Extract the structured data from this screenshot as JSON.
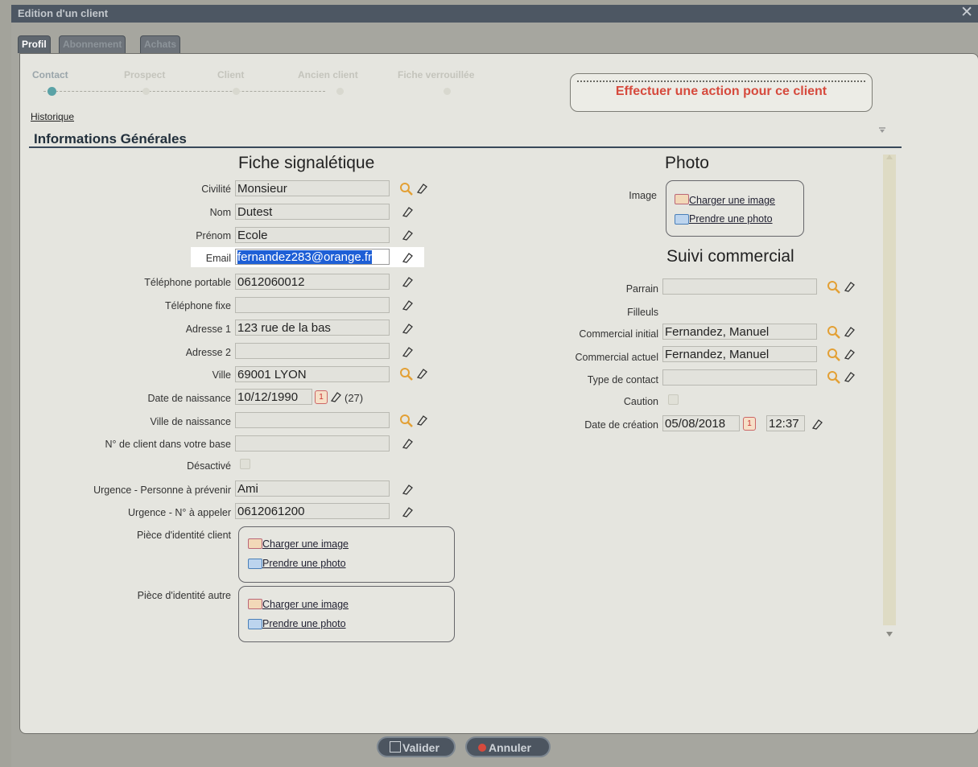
{
  "window": {
    "title": "Edition d'un client"
  },
  "tabs": [
    {
      "label": "Profil",
      "active": true
    },
    {
      "label": "Abonnement",
      "active": false
    },
    {
      "label": "Achats",
      "active": false
    }
  ],
  "stepper": [
    "Contact",
    "Prospect",
    "Client",
    "Ancien client",
    "Fiche verrouillée"
  ],
  "action_button": "Effectuer une action pour ce client",
  "historique_link": "Historique",
  "section_title": "Informations Générales",
  "fiche": {
    "heading": "Fiche signalétique",
    "fields": {
      "civilite": {
        "label": "Civilité",
        "value": "Monsieur"
      },
      "nom": {
        "label": "Nom",
        "value": "Dutest"
      },
      "prenom": {
        "label": "Prénom",
        "value": "Ecole"
      },
      "email": {
        "label": "Email",
        "value": "fernandez283@orange.fr"
      },
      "tel_portable": {
        "label": "Téléphone portable",
        "value": "0612060012"
      },
      "tel_fixe": {
        "label": "Téléphone fixe",
        "value": ""
      },
      "adresse1": {
        "label": "Adresse 1",
        "value": "123 rue de la bas"
      },
      "adresse2": {
        "label": "Adresse 2",
        "value": ""
      },
      "ville": {
        "label": "Ville",
        "value": "69001 LYON"
      },
      "date_naissance": {
        "label": "Date de naissance",
        "value": "10/12/1990",
        "age": "(27)"
      },
      "ville_naissance": {
        "label": "Ville de naissance",
        "value": ""
      },
      "num_client": {
        "label": "N° de client dans votre base",
        "value": ""
      },
      "desactive": {
        "label": "Désactivé"
      },
      "urgence_personne": {
        "label": "Urgence - Personne à prévenir",
        "value": "Ami"
      },
      "urgence_numero": {
        "label": "Urgence - N° à appeler",
        "value": "0612061200"
      },
      "piece_client": {
        "label": "Pièce d'identité client"
      },
      "piece_autre": {
        "label": "Pièce d'identité autre"
      }
    }
  },
  "upload": {
    "charger": "Charger une image",
    "photo": "Prendre une photo"
  },
  "calendar_day": "1",
  "photo": {
    "heading": "Photo",
    "image_label": "Image"
  },
  "suivi": {
    "heading": "Suivi commercial",
    "parrain": {
      "label": "Parrain",
      "value": ""
    },
    "filleuls": {
      "label": "Filleuls"
    },
    "commercial_initial": {
      "label": "Commercial initial",
      "value": "Fernandez, Manuel"
    },
    "commercial_actuel": {
      "label": "Commercial actuel",
      "value": "Fernandez, Manuel"
    },
    "type_contact": {
      "label": "Type de contact",
      "value": ""
    },
    "caution": {
      "label": "Caution"
    },
    "date_creation": {
      "label": "Date de création",
      "value": "05/08/2018",
      "time": "12:37"
    }
  },
  "footer": {
    "valider": "Valider",
    "annuler": "Annuler"
  },
  "colors": {
    "accent_red": "#d64a3d",
    "titlebar": "#4d5763",
    "panel": "#e5e5df",
    "selection": "#1e5fd6"
  }
}
